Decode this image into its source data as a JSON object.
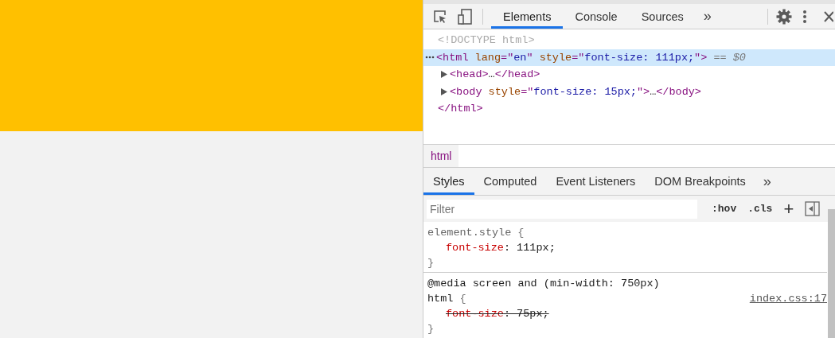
{
  "devtools": {
    "tabs": [
      {
        "label": "Elements",
        "selected": true
      },
      {
        "label": "Console",
        "selected": false
      },
      {
        "label": "Sources",
        "selected": false
      }
    ],
    "more_tabs": "»",
    "dom_tree": [
      {
        "selected": false,
        "segments": [
          {
            "kind": "doctype",
            "text": "<!DOCTYPE html>"
          }
        ]
      },
      {
        "selected": true,
        "segments": [
          {
            "kind": "tag",
            "text": "<html"
          },
          {
            "kind": "attr",
            "text": " lang"
          },
          {
            "kind": "punct",
            "text": "=\""
          },
          {
            "kind": "value",
            "text": "en"
          },
          {
            "kind": "punct",
            "text": "\""
          },
          {
            "kind": "attr",
            "text": " style"
          },
          {
            "kind": "punct",
            "text": "=\""
          },
          {
            "kind": "value",
            "text": "font-size: 111px;"
          },
          {
            "kind": "punct",
            "text": "\">"
          },
          {
            "kind": "marker",
            "text": " == "
          },
          {
            "kind": "var",
            "text": "$0"
          }
        ],
        "children": [
          {
            "selected": false,
            "expanded": false,
            "segments": [
              {
                "kind": "tag",
                "text": "<head>"
              },
              {
                "kind": "plain",
                "text": "…"
              },
              {
                "kind": "tag",
                "text": "</head>"
              }
            ]
          },
          {
            "selected": false,
            "expanded": false,
            "segments": [
              {
                "kind": "tag",
                "text": "<body"
              },
              {
                "kind": "attr",
                "text": " style"
              },
              {
                "kind": "punct",
                "text": "=\""
              },
              {
                "kind": "value",
                "text": "font-size: 15px;"
              },
              {
                "kind": "punct",
                "text": "\">"
              },
              {
                "kind": "plain",
                "text": "…"
              },
              {
                "kind": "tag",
                "text": "</body>"
              }
            ]
          }
        ],
        "closing": [
          {
            "kind": "tag",
            "text": "</html>"
          }
        ]
      }
    ],
    "breadcrumb": "html",
    "sidebar_tabs": [
      {
        "label": "Styles",
        "selected": true
      },
      {
        "label": "Computed",
        "selected": false
      },
      {
        "label": "Event Listeners",
        "selected": false
      },
      {
        "label": "DOM Breakpoints",
        "selected": false
      }
    ],
    "sidebar_more": "»",
    "filter": {
      "placeholder": "Filter"
    },
    "hov": ":hov",
    "cls": ".cls",
    "add_rule": "+",
    "rules": [
      {
        "selector": "element.style",
        "open": "{",
        "close": "}",
        "declarations": [
          {
            "property": "font-size",
            "separator": ":",
            "value": "111px;",
            "overridden": false
          }
        ]
      },
      {
        "media": "@media screen and (min-width: 750px)",
        "selector": "html",
        "open": "{",
        "close": "}",
        "source": "index.css:17",
        "declarations": [
          {
            "property": "font-size",
            "separator": ":",
            "value": "75px;",
            "overridden": true
          }
        ]
      }
    ]
  }
}
